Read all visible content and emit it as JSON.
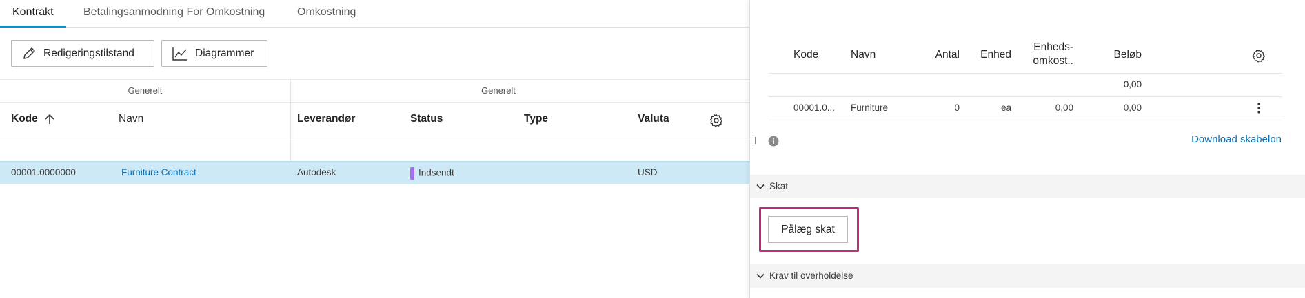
{
  "tabs": [
    {
      "label": "Kontrakt",
      "active": true
    },
    {
      "label": "Betalingsanmodning For Omkostning",
      "active": false
    },
    {
      "label": "Omkostning",
      "active": false
    }
  ],
  "toolbar": {
    "edit_label": "Redigeringstilstand",
    "charts_label": "Diagrammer"
  },
  "grid": {
    "groups": [
      "Generelt",
      "Generelt"
    ],
    "columns": {
      "code": "Kode",
      "name": "Navn",
      "supplier": "Leverandør",
      "status": "Status",
      "type": "Type",
      "currency": "Valuta"
    },
    "rows": [
      {
        "code": "00001.0000000",
        "name": "Furniture Contract",
        "supplier": "Autodesk",
        "status": "Indsendt",
        "type": "",
        "currency": "USD"
      }
    ]
  },
  "panel": {
    "columns": {
      "code": "Kode",
      "name": "Navn",
      "qty": "Antal",
      "unit": "Enhed",
      "unit_cost_line1": "Enheds-",
      "unit_cost_line2": "omkost..",
      "amount": "Beløb"
    },
    "total": "0,00",
    "rows": [
      {
        "code": "00001.0...",
        "name": "Furniture",
        "qty": "0",
        "unit": "ea",
        "unit_cost": "0,00",
        "amount": "0,00"
      }
    ],
    "download_label": "Download skabelon",
    "sections": {
      "tax": "Skat",
      "apply_tax_label": "Pålæg skat",
      "compliance": "Krav til overholdelse"
    }
  },
  "colors": {
    "accent": "#0696d7",
    "selected_row": "#cde9f5",
    "status_submitted": "#a56df0",
    "highlight": "#c0287a",
    "link": "#0a6fb3"
  }
}
